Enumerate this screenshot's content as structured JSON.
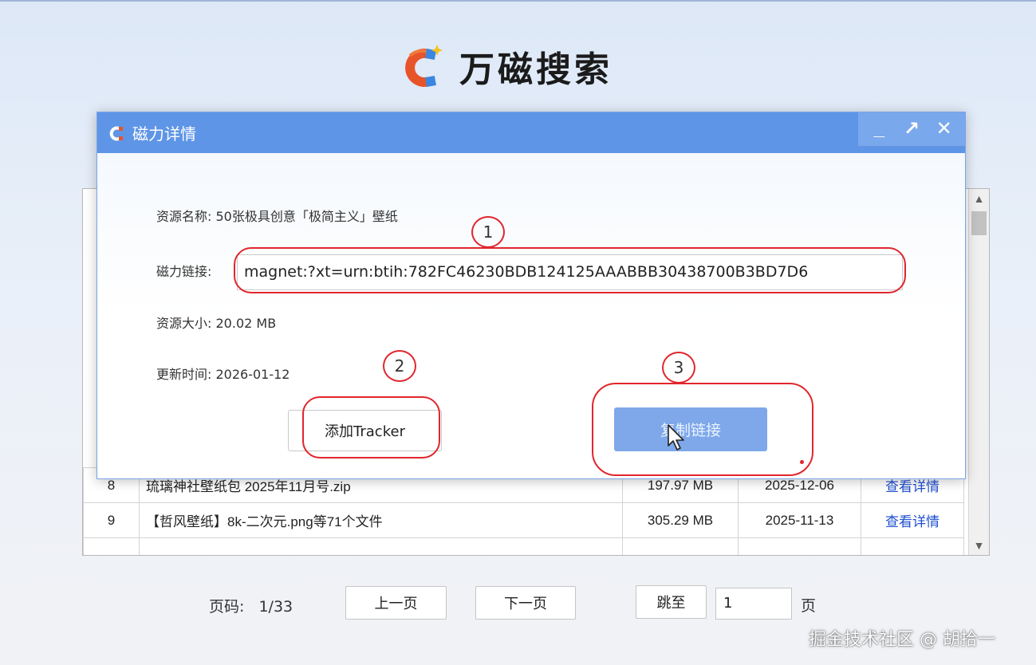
{
  "app": {
    "title": "万磁搜索"
  },
  "table": {
    "rows": [
      {
        "index": "8",
        "name": "琉璃神社壁纸包 2025年11月号.zip",
        "size": "197.97 MB",
        "date": "2025-12-06",
        "action": "查看详情"
      },
      {
        "index": "9",
        "name": "【哲风壁纸】8k-二次元.png等71个文件",
        "size": "305.29 MB",
        "date": "2025-11-13",
        "action": "查看详情"
      }
    ]
  },
  "dialog": {
    "title": "磁力详情",
    "controls": {
      "minimize": "_",
      "maximize": "↗",
      "close": "✕"
    },
    "fields": {
      "name_label": "资源名称:",
      "name_value": "50张极具创意「极简主义」壁纸",
      "magnet_label": "磁力链接:",
      "magnet_value": "magnet:?xt=urn:btih:782FC46230BDB124125AAABBB30438700B3BD7D6",
      "size_label": "资源大小:",
      "size_value": "20.02 MB",
      "time_label": "更新时间:",
      "time_value": "2026-01-12"
    },
    "buttons": {
      "add_tracker": "添加Tracker",
      "copy_link": "复制链接"
    },
    "annotations": [
      "1",
      "2",
      "3"
    ]
  },
  "pagination": {
    "label": "页码:",
    "value": "1/33",
    "prev": "上一页",
    "next": "下一页",
    "jump": "跳至",
    "input_value": "1",
    "suffix": "页"
  },
  "watermark": "掘金技术社区 @ 胡拾一",
  "colors": {
    "titlebar": "#5e95e6",
    "copy_button": "#7ea8ea",
    "annotation": "#e0262d",
    "link": "#1f4fd1"
  }
}
